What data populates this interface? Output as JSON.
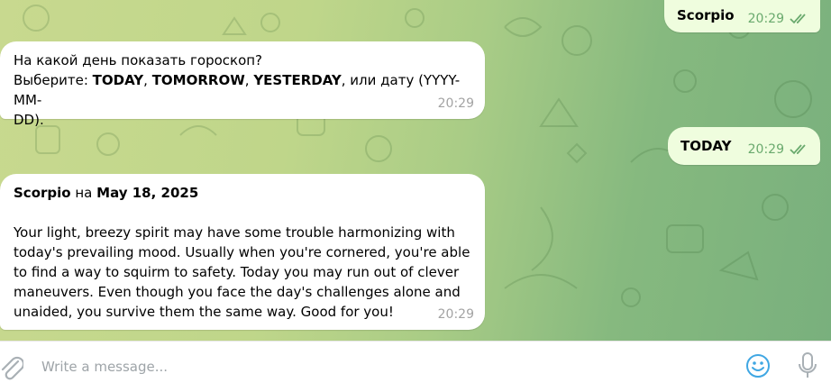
{
  "messages": {
    "sent_sign": {
      "text": "Scorpio",
      "time": "20:29"
    },
    "prompt": {
      "line1": "На какой день показать гороскоп?",
      "line2_prefix": "Выберите: ",
      "opt_today": "TODAY",
      "sep1": ", ",
      "opt_tomorrow": "TOMORROW",
      "sep2": ", ",
      "opt_yesterday": "YESTERDAY",
      "line2_suffix": ", или дату (YYYY-MM-",
      "line3": "DD).",
      "time": "20:29"
    },
    "sent_today": {
      "text": "TODAY",
      "time": "20:29"
    },
    "horoscope": {
      "sign": "Scorpio",
      "on": " на ",
      "date": "May 18, 2025",
      "lines": [
        "Your light, breezy spirit may have some trouble harmonizing with",
        "today's prevailing mood. Usually when you're cornered, you're able",
        "to find a way to squirm to safety. Today you may run out of clever",
        "maneuvers. Even though you face the day's challenges alone and",
        "unaided, you survive them the same way. Good for you!"
      ],
      "time": "20:29"
    }
  },
  "composer": {
    "placeholder": "Write a message..."
  },
  "colors": {
    "accent": "#40a7e3",
    "outgoing_bubble": "#effdde",
    "check_green": "#6aaa6e"
  },
  "icons": {
    "attach": "paperclip-icon",
    "emoji": "smile-icon",
    "mic": "microphone-icon",
    "read": "double-check-icon"
  }
}
